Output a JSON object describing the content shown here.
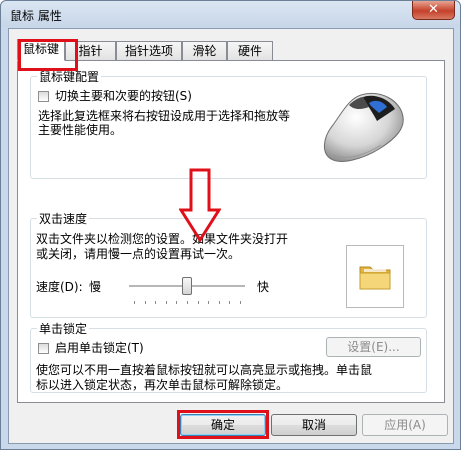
{
  "window": {
    "title": "鼠标 属性",
    "close_icon": "close-icon"
  },
  "tabs": [
    {
      "label": "鼠标键"
    },
    {
      "label": "指针"
    },
    {
      "label": "指针选项"
    },
    {
      "label": "滑轮"
    },
    {
      "label": "硬件"
    }
  ],
  "button_config": {
    "legend": "鼠标键配置",
    "switch_label": "切换主要和次要的按钮(S)",
    "switch_checked": false,
    "description_line1": "选择此复选框来将右按钮设成用于选择和拖放等",
    "description_line2": "主要性能使用。"
  },
  "double_click": {
    "legend": "双击速度",
    "description_line1": "双击文件夹以检测您的设置。如果文件夹没打开",
    "description_line2": "或关闭，请用慢一点的设置再试一次。",
    "speed_label": "速度(D):",
    "slow": "慢",
    "fast": "快",
    "speed_fraction": 0.5
  },
  "click_lock": {
    "legend": "单击锁定",
    "enable_label": "启用单击锁定(T)",
    "enable_checked": false,
    "settings_button": "设置(E)...",
    "description_line1": "使您可以不用一直按着鼠标按钮就可以高亮显示或拖拽。单击鼠",
    "description_line2": "标以进入锁定状态，再次单击鼠标可解除锁定。"
  },
  "footer": {
    "ok": "确定",
    "cancel": "取消",
    "apply": "应用(A)"
  },
  "colors": {
    "annotation": "#e0101a",
    "accent": "#3c7fb1"
  }
}
